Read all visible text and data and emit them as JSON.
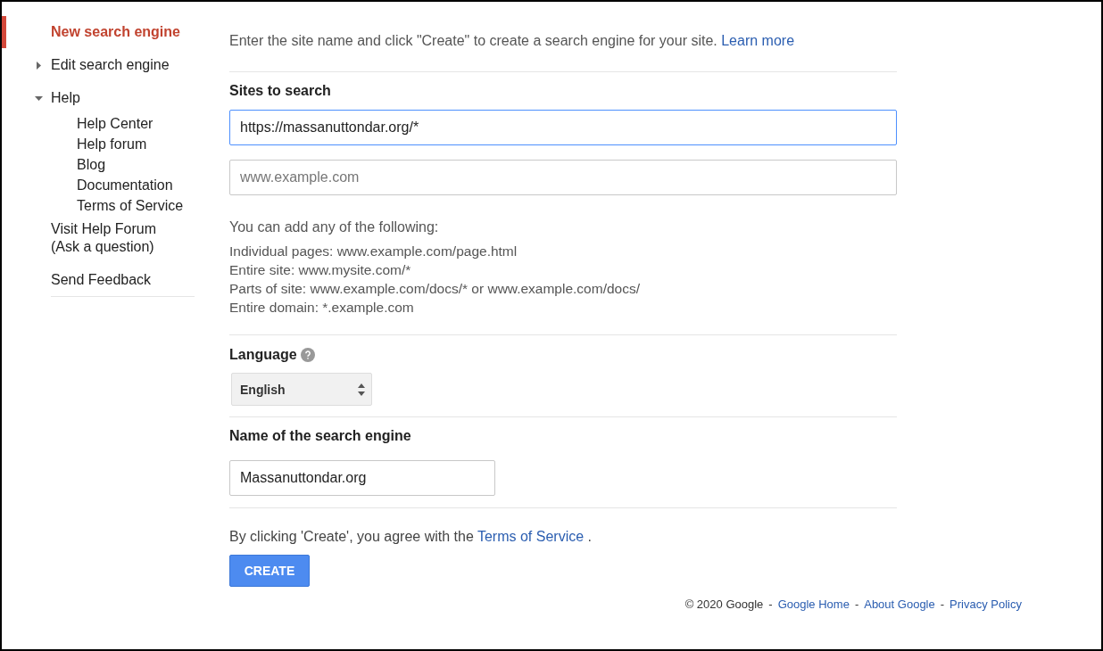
{
  "sidebar": {
    "items": [
      {
        "kind": "leaf",
        "label": "New search engine",
        "selected": true
      },
      {
        "kind": "branch",
        "label": "Edit search engine",
        "selected": false,
        "expanded": false
      },
      {
        "kind": "branch",
        "label": "Help",
        "selected": false,
        "expanded": true,
        "children": [
          {
            "label": "Help Center"
          },
          {
            "label": "Help forum"
          },
          {
            "label": "Blog"
          },
          {
            "label": "Documentation"
          },
          {
            "label": "Terms of Service"
          }
        ]
      },
      {
        "kind": "leaf",
        "label": "Visit Help Forum (Ask a question)",
        "selected": false
      },
      {
        "kind": "leaf",
        "label": "Send Feedback",
        "selected": false
      }
    ]
  },
  "intro": {
    "text": "Enter the site name and click \"Create\" to create a search engine for your site.",
    "link": "Learn more"
  },
  "sites": {
    "label": "Sites to search",
    "fields": [
      {
        "value": "https://massanuttondar.org/*",
        "focused": true
      },
      {
        "placeholder": "www.example.com",
        "focused": false
      }
    ],
    "hint_title": "You can add any of the following:",
    "hints": [
      "Individual pages: www.example.com/page.html",
      "Entire site: www.mysite.com/*",
      "Parts of site: www.example.com/docs/* or www.example.com/docs/",
      "Entire domain: *.example.com"
    ]
  },
  "language": {
    "label": "Language",
    "value": "English"
  },
  "engine_name": {
    "label": "Name of the search engine",
    "value": "Massanuttondar.org"
  },
  "terms": {
    "text": "By clicking 'Create', you agree with the",
    "link": "Terms of Service",
    "after": "."
  },
  "create_button": "CREATE",
  "footer": {
    "copyright": "© 2020 Google",
    "separator": "-",
    "links": [
      "Google Home",
      "About Google",
      "Privacy Policy"
    ]
  }
}
